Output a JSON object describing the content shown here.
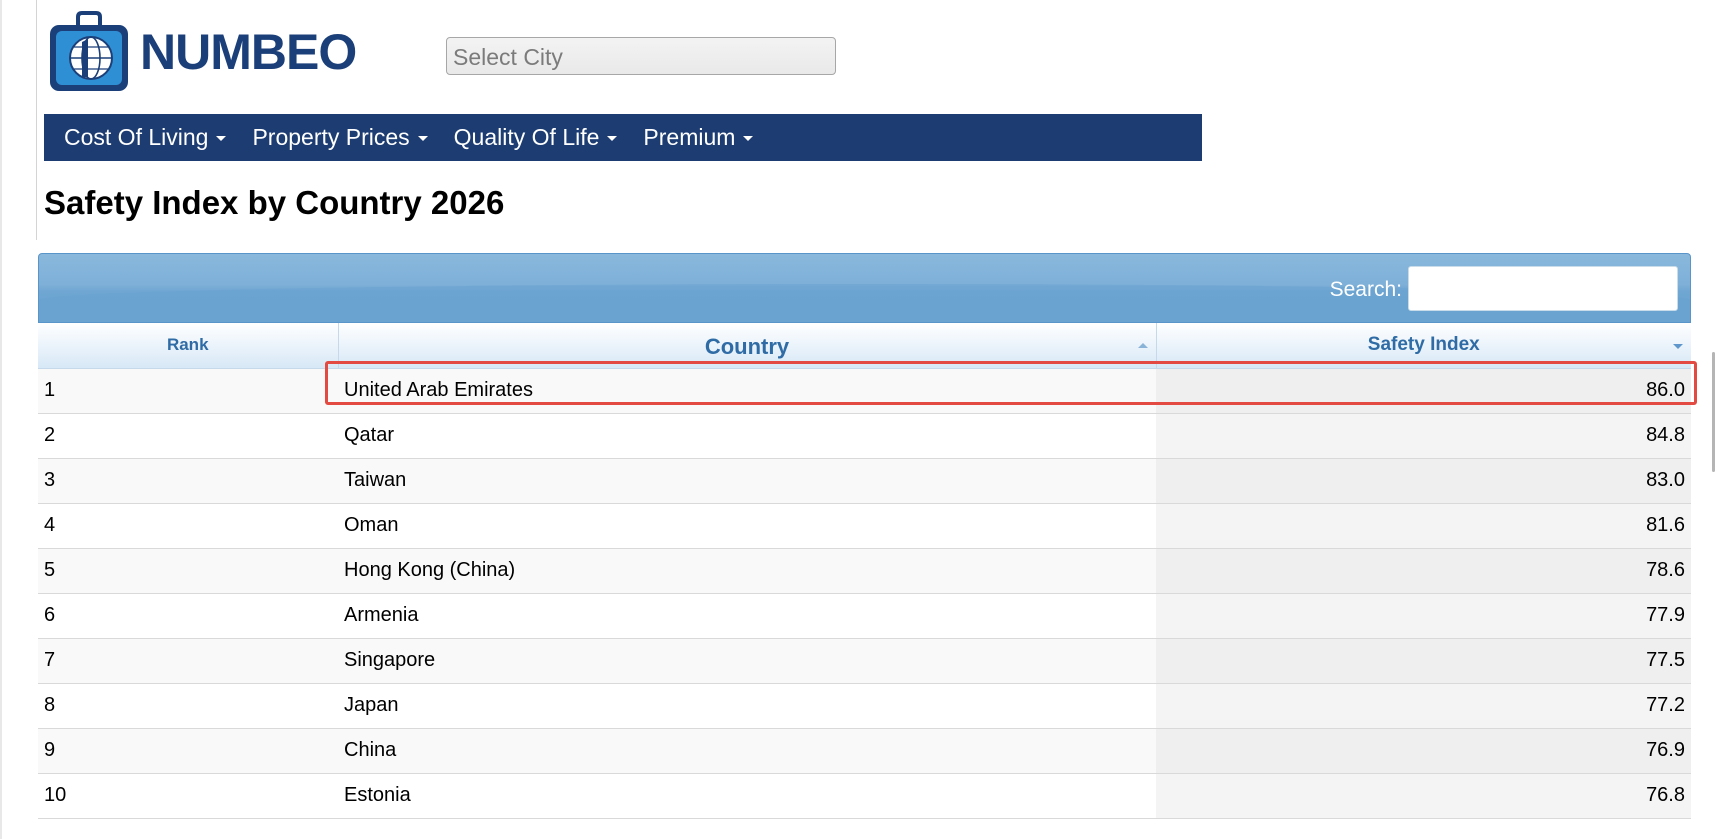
{
  "brand": {
    "name": "NUMBEO"
  },
  "city_select": {
    "placeholder": "Select City"
  },
  "nav": {
    "items": [
      {
        "label": "Cost Of Living"
      },
      {
        "label": "Property Prices"
      },
      {
        "label": "Quality Of Life"
      },
      {
        "label": "Premium"
      }
    ]
  },
  "page": {
    "title": "Safety Index by Country 2026"
  },
  "table": {
    "search_label": "Search:",
    "search_value": "",
    "columns": {
      "rank": "Rank",
      "country": "Country",
      "safety_index": "Safety Index"
    },
    "rows": [
      {
        "rank": "1",
        "country": "United Arab Emirates",
        "value": "86.0"
      },
      {
        "rank": "2",
        "country": "Qatar",
        "value": "84.8"
      },
      {
        "rank": "3",
        "country": "Taiwan",
        "value": "83.0"
      },
      {
        "rank": "4",
        "country": "Oman",
        "value": "81.6"
      },
      {
        "rank": "5",
        "country": "Hong Kong (China)",
        "value": "78.6"
      },
      {
        "rank": "6",
        "country": "Armenia",
        "value": "77.9"
      },
      {
        "rank": "7",
        "country": "Singapore",
        "value": "77.5"
      },
      {
        "rank": "8",
        "country": "Japan",
        "value": "77.2"
      },
      {
        "rank": "9",
        "country": "China",
        "value": "76.9"
      },
      {
        "rank": "10",
        "country": "Estonia",
        "value": "76.8"
      }
    ]
  },
  "colors": {
    "nav_bg": "#1c3c72",
    "brand_text": "#1b3f79",
    "header_text": "#2f6ca6",
    "highlight_border": "#e24a42"
  },
  "icons": {
    "logo": "numbeo-suitcase-globe-icon",
    "nav_caret": "caret-down-icon",
    "sort_asc": "sort-asc-icon",
    "sort_desc": "sort-desc-icon"
  }
}
